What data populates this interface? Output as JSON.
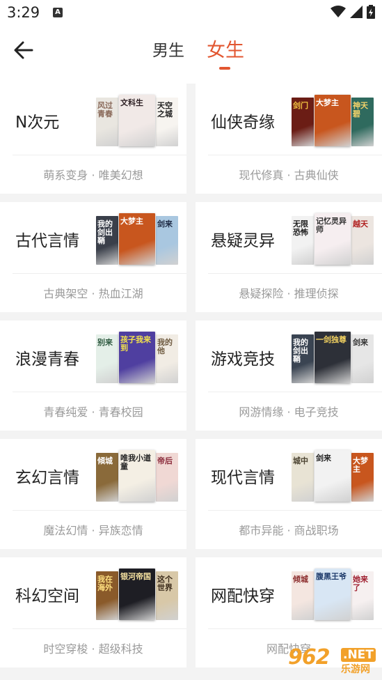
{
  "status_bar": {
    "time": "3:29",
    "notification_letter": "A"
  },
  "header": {
    "tab_male": "男生",
    "tab_female": "女生",
    "active_tab": "女生"
  },
  "categories": [
    {
      "title": "N次元",
      "subtitle": "萌系变身 · 唯美幻想",
      "covers": [
        {
          "text": "风过青春",
          "bg": "#e9e6e0",
          "fg": "#8a6a5a"
        },
        {
          "text": "文科生",
          "bg": "#f1e9e7",
          "fg": "#2b1e22"
        },
        {
          "text": "天空之城",
          "bg": "#f7f4f0",
          "fg": "#222222"
        }
      ]
    },
    {
      "title": "仙侠奇缘",
      "subtitle": "现代修真 · 古典仙侠",
      "covers": [
        {
          "text": "剑门",
          "bg": "#6b1d15",
          "fg": "#f0c040"
        },
        {
          "text": "大梦主",
          "bg": "#c8561e",
          "fg": "#ffffff"
        },
        {
          "text": "神天碧",
          "bg": "#2f6a5e",
          "fg": "#f4d36a"
        }
      ]
    },
    {
      "title": "古代言情",
      "subtitle": "古典架空 · 热血江湖",
      "covers": [
        {
          "text": "我的剑出鞘",
          "bg": "#3a3f4a",
          "fg": "#ffffff"
        },
        {
          "text": "大梦主",
          "bg": "#c8561e",
          "fg": "#ffffff"
        },
        {
          "text": "剑来",
          "bg": "#a9c7e0",
          "fg": "#1e2a44"
        }
      ]
    },
    {
      "title": "悬疑灵异",
      "subtitle": "悬疑探险 · 推理侦探",
      "covers": [
        {
          "text": "无限恐怖",
          "bg": "#f2f2f2",
          "fg": "#222222"
        },
        {
          "text": "记忆灵异师",
          "bg": "#f6eef0",
          "fg": "#333333"
        },
        {
          "text": "越天",
          "bg": "#ece5e0",
          "fg": "#b02020"
        }
      ]
    },
    {
      "title": "浪漫青春",
      "subtitle": "青春纯爱 · 青春校园",
      "covers": [
        {
          "text": "别来",
          "bg": "#e4efe8",
          "fg": "#2e5a40"
        },
        {
          "text": "孩子我来到",
          "bg": "#4f3fa0",
          "fg": "#f4e34a"
        },
        {
          "text": "我的他",
          "bg": "#f1ece4",
          "fg": "#6e5a40"
        }
      ]
    },
    {
      "title": "游戏竞技",
      "subtitle": "网游情缘 · 电子竞技",
      "covers": [
        {
          "text": "我的剑出鞘",
          "bg": "#3a4452",
          "fg": "#ffffff"
        },
        {
          "text": "一剑独尊",
          "bg": "#2d3038",
          "fg": "#f0d060"
        },
        {
          "text": "剑来",
          "bg": "#e6e6e6",
          "fg": "#333333"
        }
      ]
    },
    {
      "title": "玄幻言情",
      "subtitle": "魔法幻情 · 异族恋情",
      "covers": [
        {
          "text": "傾城",
          "bg": "#8a6a3a",
          "fg": "#ffffff"
        },
        {
          "text": "唯我小道童",
          "bg": "#f4efe4",
          "fg": "#222222"
        },
        {
          "text": "帝后",
          "bg": "#f0d8d4",
          "fg": "#8a2a3a"
        }
      ]
    },
    {
      "title": "现代言情",
      "subtitle": "都市异能 · 商战职场",
      "covers": [
        {
          "text": "城中",
          "bg": "#e8e3d4",
          "fg": "#4a4230"
        },
        {
          "text": "剑来",
          "bg": "#f2f2f2",
          "fg": "#222222"
        },
        {
          "text": "大梦主",
          "bg": "#c8561e",
          "fg": "#ffffff"
        }
      ]
    },
    {
      "title": "科幻空间",
      "subtitle": "时空穿梭 · 超级科技",
      "covers": [
        {
          "text": "我在海外",
          "bg": "#8a5a2a",
          "fg": "#ffe080"
        },
        {
          "text": "银河帝国",
          "bg": "#1e1e24",
          "fg": "#f4e0a0"
        },
        {
          "text": "这个世界",
          "bg": "#d8c8a8",
          "fg": "#3a2a1a"
        }
      ]
    },
    {
      "title": "网配快穿",
      "subtitle": "网配快穿",
      "covers": [
        {
          "text": "倾城",
          "bg": "#f4e6e0",
          "fg": "#8a2a2a"
        },
        {
          "text": "腹黑王爷",
          "bg": "#d8e6f4",
          "fg": "#1e3a6a"
        },
        {
          "text": "她来了",
          "bg": "#f6f0f0",
          "fg": "#a02030"
        }
      ]
    }
  ],
  "watermark": {
    "logo": "962",
    "net": ".NET",
    "sub": "乐游网"
  },
  "colors": {
    "accent": "#e25630",
    "subtitle": "#9a9a9a",
    "background": "#f3f3f3"
  }
}
